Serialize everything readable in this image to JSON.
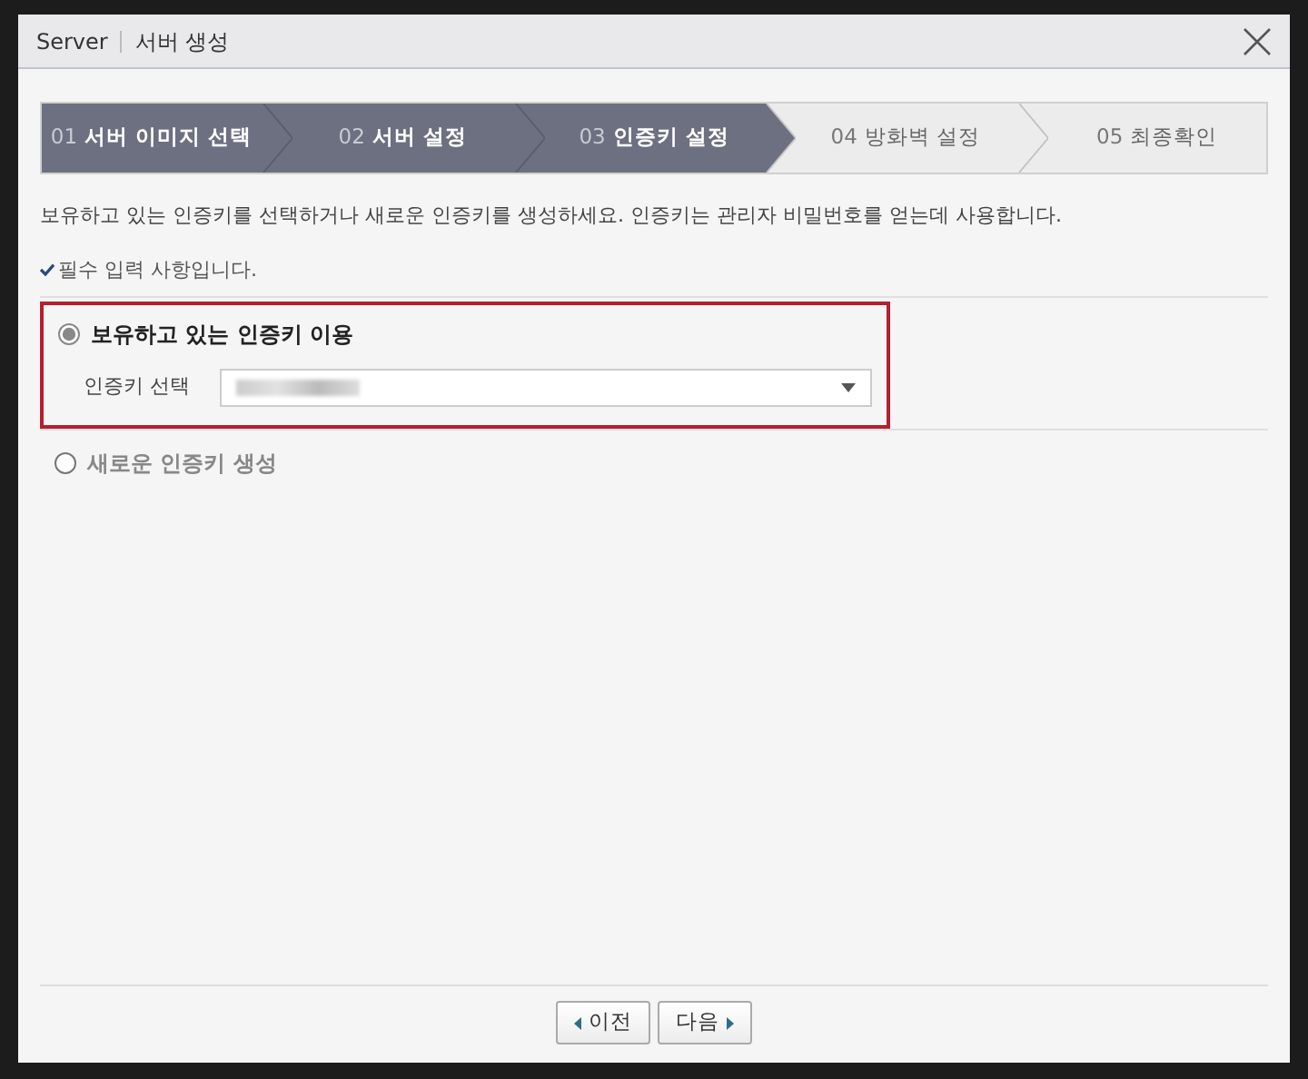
{
  "window": {
    "title": "Server",
    "subtitle": "서버 생성"
  },
  "steps": [
    {
      "number": "01",
      "label": "서버 이미지 선택",
      "reached": true
    },
    {
      "number": "02",
      "label": "서버 설정",
      "reached": true
    },
    {
      "number": "03",
      "label": "인증키 설정",
      "reached": true
    },
    {
      "number": "04",
      "label": "방화벽 설정",
      "reached": false
    },
    {
      "number": "05",
      "label": "최종확인",
      "reached": false
    }
  ],
  "description": "보유하고 있는 인증키를 선택하거나 새로운 인증키를 생성하세요. 인증키는 관리자 비밀번호를 얻는데 사용합니다.",
  "required_note": "필수 입력 사항입니다.",
  "options": [
    {
      "label": "보유하고 있는 인증키 이용",
      "selected": true,
      "field": {
        "label": "인증키 선택"
      }
    },
    {
      "label": "새로운 인증키 생성",
      "selected": false
    }
  ],
  "buttons": [
    {
      "label": "이전",
      "kind": "prev"
    },
    {
      "label": "다음",
      "kind": "next"
    }
  ]
}
